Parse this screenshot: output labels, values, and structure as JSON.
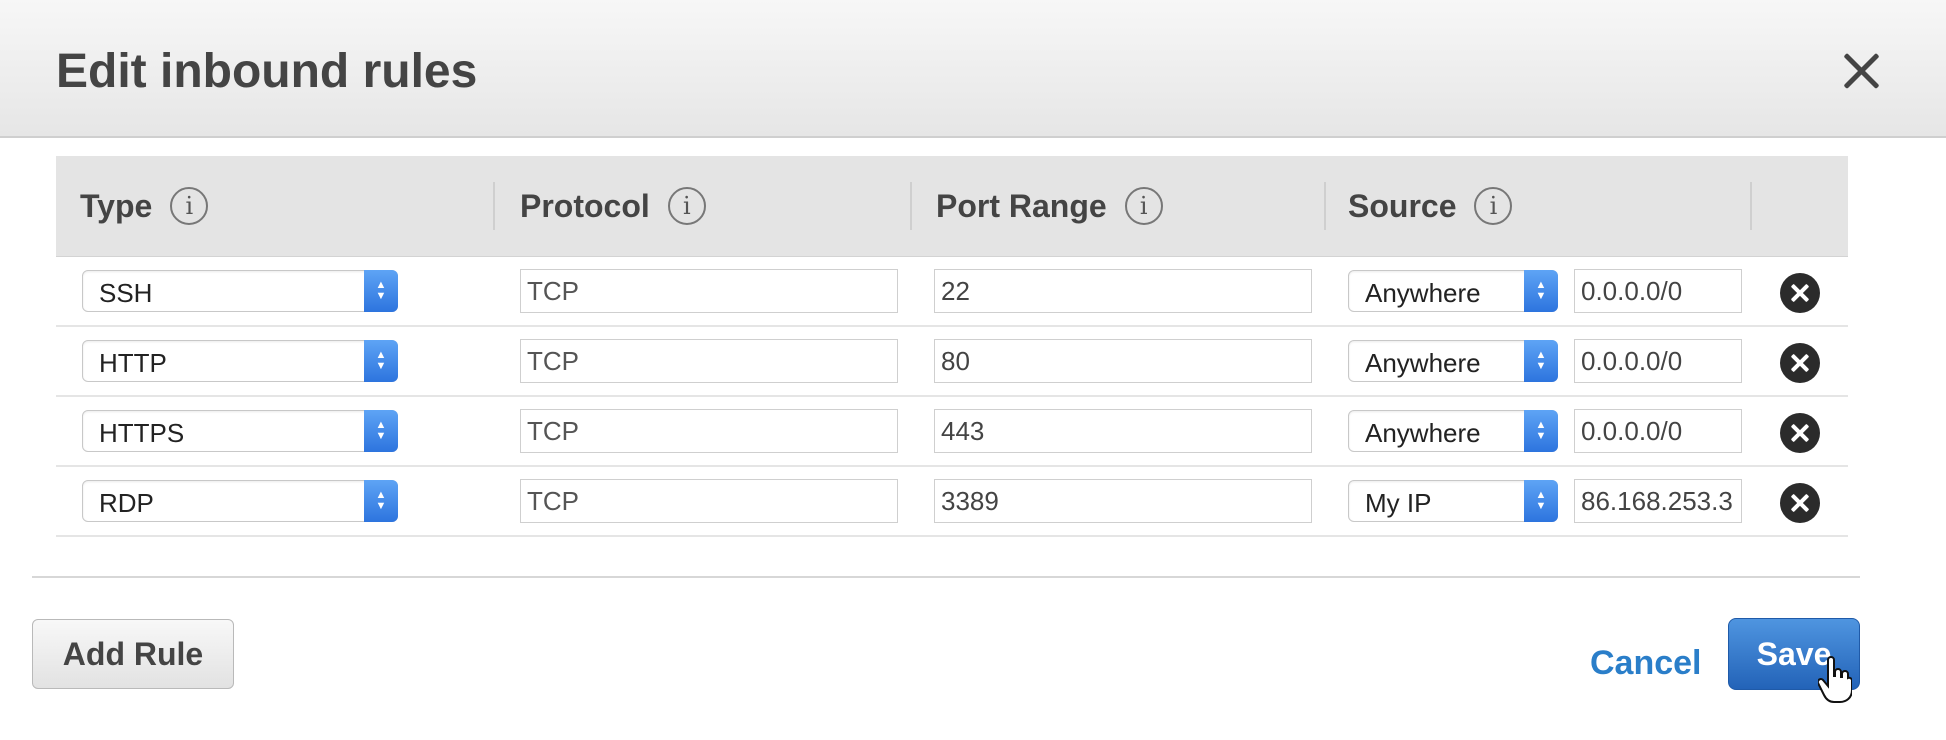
{
  "dialog": {
    "title": "Edit inbound rules"
  },
  "table": {
    "headers": [
      "Type",
      "Protocol",
      "Port Range",
      "Source"
    ],
    "rows": [
      {
        "type": "SSH",
        "protocol": "TCP",
        "port_range": "22",
        "source": "Anywhere",
        "cidr": "0.0.0.0/0"
      },
      {
        "type": "HTTP",
        "protocol": "TCP",
        "port_range": "80",
        "source": "Anywhere",
        "cidr": "0.0.0.0/0"
      },
      {
        "type": "HTTPS",
        "protocol": "TCP",
        "port_range": "443",
        "source": "Anywhere",
        "cidr": "0.0.0.0/0"
      },
      {
        "type": "RDP",
        "protocol": "TCP",
        "port_range": "3389",
        "source": "My IP",
        "cidr": "86.168.253.3"
      }
    ]
  },
  "footer": {
    "add_rule_label": "Add Rule",
    "cancel_label": "Cancel",
    "save_label": "Save"
  },
  "colors": {
    "primary_button": "#2e6fc4",
    "link": "#2a7ec9",
    "select_chevron": "#3a82e6"
  },
  "icons": {
    "close": "close-icon",
    "info": "info-icon",
    "remove": "remove-rule-icon",
    "cursor": "hand-cursor-icon"
  }
}
